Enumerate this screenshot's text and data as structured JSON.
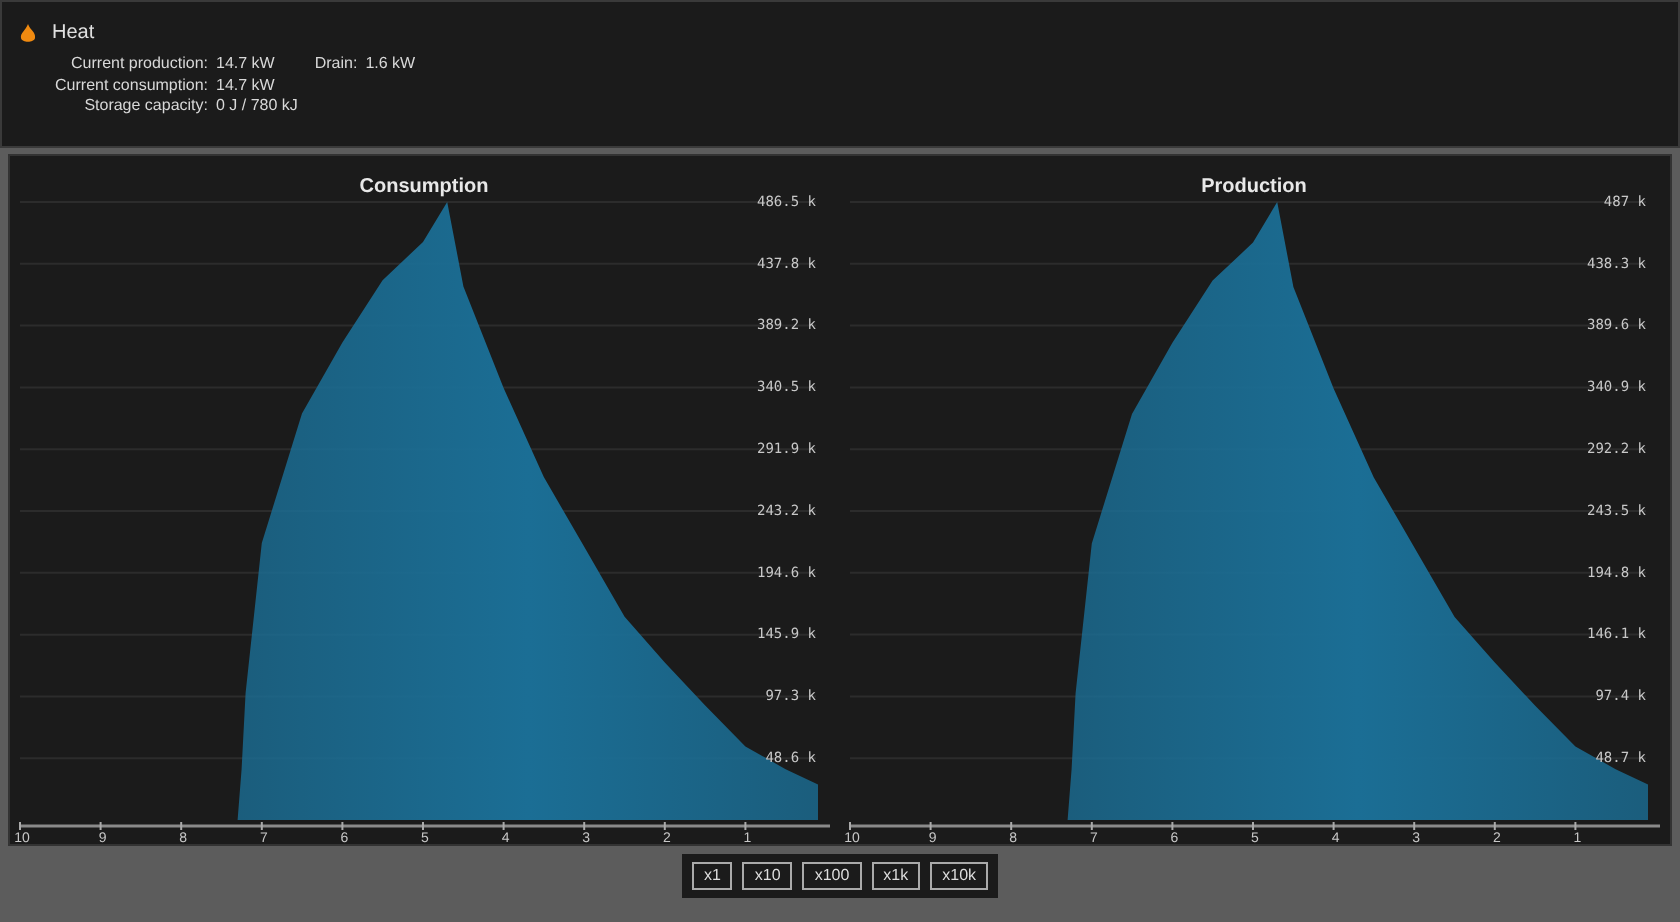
{
  "header": {
    "title": "Heat",
    "stats": [
      {
        "label": "Current production:",
        "value": "14.7 kW",
        "extra_label": "Drain:",
        "extra_value": "1.6 kW"
      },
      {
        "label": "Current consumption:",
        "value": "14.7 kW"
      },
      {
        "label": "Storage capacity:",
        "value": "0 J / 780 kJ"
      }
    ]
  },
  "charts": [
    {
      "chart_data": {
        "type": "area",
        "title": "Consumption",
        "x": [
          7.3,
          7.25,
          7.2,
          7,
          6.5,
          6,
          5.5,
          5,
          4.7,
          4.5,
          4,
          3.5,
          3,
          2.5,
          2,
          1.5,
          1,
          0.5,
          0.1
        ],
        "xlim": [
          10,
          0
        ],
        "ylim": [
          0,
          486500
        ],
        "grid": true,
        "series": [
          {
            "color": "#1b6e95",
            "values": [
              0,
              40000,
              100000,
              218000,
              320000,
              376000,
              425000,
              455000,
              486500,
              420000,
              340000,
              270000,
              215000,
              160000,
              124000,
              90000,
              58000,
              40000,
              28000
            ]
          }
        ],
        "xticks": [
          10,
          9,
          8,
          7,
          6,
          5,
          4,
          3,
          2,
          1
        ],
        "yticks": [
          {
            "value": 48600,
            "label": "48.6 k"
          },
          {
            "value": 97300,
            "label": "97.3 k"
          },
          {
            "value": 145900,
            "label": "145.9 k"
          },
          {
            "value": 194600,
            "label": "194.6 k"
          },
          {
            "value": 243200,
            "label": "243.2 k"
          },
          {
            "value": 291900,
            "label": "291.9 k"
          },
          {
            "value": 340500,
            "label": "340.5 k"
          },
          {
            "value": 389200,
            "label": "389.2 k"
          },
          {
            "value": 437800,
            "label": "437.8 k"
          },
          {
            "value": 486500,
            "label": "486.5 k"
          }
        ]
      }
    },
    {
      "chart_data": {
        "type": "area",
        "title": "Production",
        "x": [
          7.3,
          7.25,
          7.2,
          7,
          6.5,
          6,
          5.5,
          5,
          4.7,
          4.5,
          4,
          3.5,
          3,
          2.5,
          2,
          1.5,
          1,
          0.5,
          0.1
        ],
        "xlim": [
          10,
          0
        ],
        "ylim": [
          0,
          487000
        ],
        "grid": true,
        "series": [
          {
            "color": "#1b6e95",
            "values": [
              0,
              40000,
              100000,
              218000,
              320000,
              376000,
              425000,
              455000,
              487000,
              420000,
              340000,
              270000,
              215000,
              160000,
              124000,
              90000,
              58000,
              40000,
              28000
            ]
          }
        ],
        "xticks": [
          10,
          9,
          8,
          7,
          6,
          5,
          4,
          3,
          2,
          1
        ],
        "yticks": [
          {
            "value": 48700,
            "label": "48.7 k"
          },
          {
            "value": 97400,
            "label": "97.4 k"
          },
          {
            "value": 146100,
            "label": "146.1 k"
          },
          {
            "value": 194800,
            "label": "194.8 k"
          },
          {
            "value": 243500,
            "label": "243.5 k"
          },
          {
            "value": 292200,
            "label": "292.2 k"
          },
          {
            "value": 340900,
            "label": "340.9 k"
          },
          {
            "value": 389600,
            "label": "389.6 k"
          },
          {
            "value": 438300,
            "label": "438.3 k"
          },
          {
            "value": 487000,
            "label": "487 k"
          }
        ]
      }
    }
  ],
  "scale_buttons": [
    {
      "label": "x1",
      "selected": false
    },
    {
      "label": "x10",
      "selected": false
    },
    {
      "label": "x100",
      "selected": false
    },
    {
      "label": "x1k",
      "selected": false
    },
    {
      "label": "x10k",
      "selected": false
    }
  ]
}
